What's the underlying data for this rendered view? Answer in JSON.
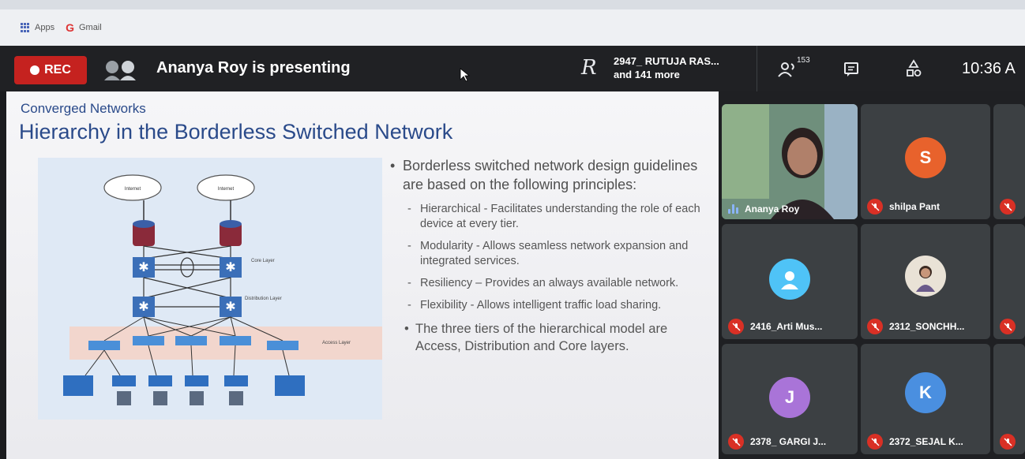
{
  "browser": {
    "bookmarks": [
      {
        "label": "Apps",
        "icon": "apps-grid-icon"
      },
      {
        "label": "Gmail",
        "icon": "google-g-icon"
      }
    ]
  },
  "meet_bar": {
    "rec_label": "REC",
    "presenting_text": "Ananya Roy is presenting",
    "viewers_line1": "2947_ RUTUJA RAS...",
    "viewers_line2": "and 141 more",
    "participant_count": "153",
    "time": "10:36 A",
    "colors": {
      "bar": "#202124",
      "rec": "#c5221f"
    }
  },
  "slide": {
    "kicker": "Converged Networks",
    "title": "Hierarchy in the Borderless Switched Network",
    "diagram": {
      "cloud_left": "Internet",
      "cloud_right": "Internet",
      "core_layer": "Core Layer",
      "distribution_layer": "Distribution Layer",
      "access_layer": "Access Layer"
    },
    "bullet_main": "Borderless switched network design guidelines are based on the following principles:",
    "sub_bullets": [
      "Hierarchical -  Facilitates understanding the role of each device at every tier.",
      "Modularity  - Allows seamless network expansion and integrated services.",
      "Resiliency – Provides an always available network.",
      "Flexibility - Allows intelligent traffic load sharing."
    ],
    "bullet_last": "The three tiers of the hierarchical model are Access, Distribution and Core layers."
  },
  "participants": [
    {
      "name": "Ananya Roy",
      "type": "video"
    },
    {
      "name": "shilpa Pant",
      "initial": "S",
      "color": "#e8622c"
    },
    {
      "name": "2416_Arti Mus...",
      "icon": "default-avatar-icon",
      "color": "#4fc3f7"
    },
    {
      "name": "2312_SONCHH...",
      "type": "photo"
    },
    {
      "name": "2378_ GARGI J...",
      "initial": "J",
      "color": "#a974d8"
    },
    {
      "name": "2372_SEJAL K...",
      "initial": "K",
      "color": "#4a8fe0"
    }
  ]
}
